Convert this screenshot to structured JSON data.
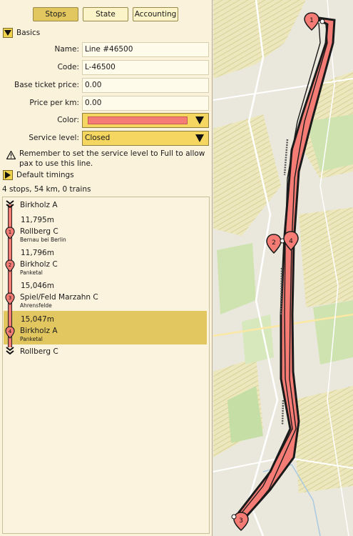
{
  "tabs": {
    "stops": "Stops",
    "state": "State",
    "accounting": "Accounting"
  },
  "basics": {
    "title": "Basics",
    "name_label": "Name:",
    "name_value": "Line #46500",
    "code_label": "Code:",
    "code_value": "L-46500",
    "base_ticket_label": "Base ticket price:",
    "base_ticket_value": "0.00",
    "price_km_label": "Price per km:",
    "price_km_value": "0.00",
    "color_label": "Color:",
    "color_value": "#f47c75",
    "service_label": "Service level:",
    "service_value": "Closed"
  },
  "warning": "Remember to set the service level to Full to allow pax to use this line.",
  "default_timings": "Default timings",
  "summary": "4 stops, 54 km, 0 trains",
  "stops": {
    "start": "Birkholz A",
    "end": "Rollberg C",
    "items": [
      {
        "number": "1",
        "distance": "11,795m",
        "name": "Rollberg C",
        "sub": "Bernau bei Berlin"
      },
      {
        "number": "2",
        "distance": "11,796m",
        "name": "Birkholz C",
        "sub": "Panketal"
      },
      {
        "number": "3",
        "distance": "15,046m",
        "name": "Spiel/Feld Marzahn C",
        "sub": "Ahrensfelde"
      },
      {
        "number": "4",
        "distance": "15,047m",
        "name": "Birkholz A",
        "sub": "Panketal"
      }
    ]
  },
  "map": {
    "markers": [
      "1",
      "2",
      "3",
      "4"
    ]
  },
  "colors": {
    "accent": "#e2c760",
    "line": "#f47c75",
    "panel": "#fbf2dc"
  }
}
